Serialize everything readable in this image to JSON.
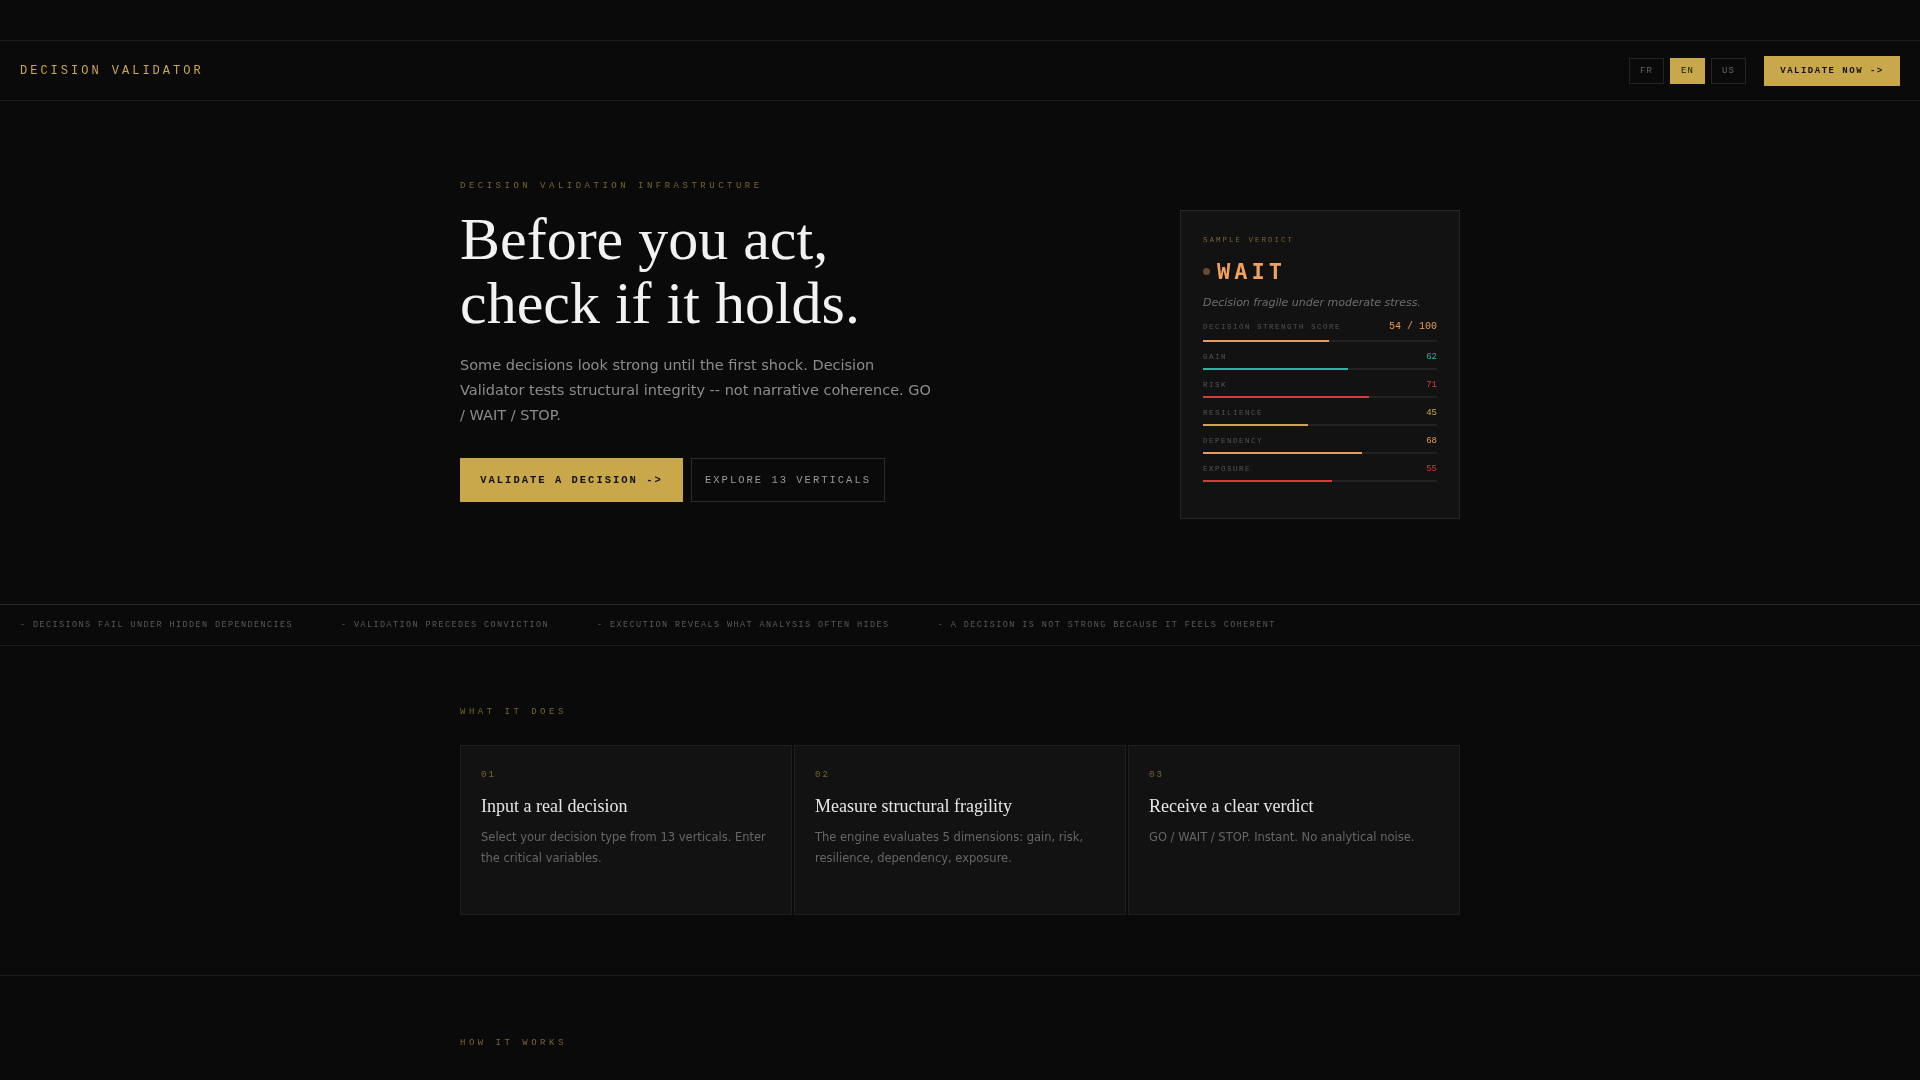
{
  "header": {
    "brand": "DECISION VALIDATOR",
    "languages": [
      {
        "label": "FR",
        "selected": false
      },
      {
        "label": "EN",
        "selected": true
      },
      {
        "label": "US",
        "selected": false
      }
    ],
    "cta": "VALIDATE NOW ->"
  },
  "hero": {
    "eyebrow": "DECISION VALIDATION INFRASTRUCTURE",
    "title_lines": [
      "Before you act,",
      "check if it holds."
    ],
    "description": "Some decisions look strong until the first shock. Decision Validator tests structural integrity -- not narrative coherence. GO / WAIT / STOP.",
    "primary_button": "VALIDATE A DECISION ->",
    "secondary_button": "EXPLORE 13 VERTICALS"
  },
  "verdict_card": {
    "label": "SAMPLE VERDICT",
    "verdict": "WAIT",
    "note": "Decision fragile under moderate stress.",
    "score_label": "DECISION STRENGTH SCORE",
    "score": "54 / 100",
    "level": 0.54,
    "metrics": [
      {
        "name": "GAIN",
        "value": "62",
        "level": 0.62,
        "color": "#2bb3a3"
      },
      {
        "name": "RISK",
        "value": "71",
        "level": 0.71,
        "color": "#d63a3a"
      },
      {
        "name": "RESILIENCE",
        "value": "45",
        "level": 0.45,
        "color": "#c9a84c"
      },
      {
        "name": "DEPENDENCY",
        "value": "68",
        "level": 0.68,
        "color": "#e89b5a"
      },
      {
        "name": "EXPOSURE",
        "value": "55",
        "level": 0.55,
        "color": "#d63a3a"
      }
    ]
  },
  "ticker": [
    "- DECISIONS FAIL UNDER HIDDEN DEPENDENCIES",
    "- VALIDATION PRECEDES CONVICTION",
    "- EXECUTION REVEALS WHAT ANALYSIS OFTEN HIDES",
    "- A DECISION IS NOT STRONG BECAUSE IT FEELS COHERENT"
  ],
  "what_it_does": {
    "label": "WHAT IT DOES",
    "cards": [
      {
        "number": "01",
        "title": "Input a real decision",
        "text": "Select your decision type from 13 verticals. Enter the critical variables."
      },
      {
        "number": "02",
        "title": "Measure structural fragility",
        "text": "The engine evaluates 5 dimensions: gain, risk, resilience, dependency, exposure."
      },
      {
        "number": "03",
        "title": "Receive a clear verdict",
        "text": "GO / WAIT / STOP. Instant. No analytical noise."
      }
    ]
  },
  "how_it_works": {
    "label": "HOW IT WORKS"
  }
}
